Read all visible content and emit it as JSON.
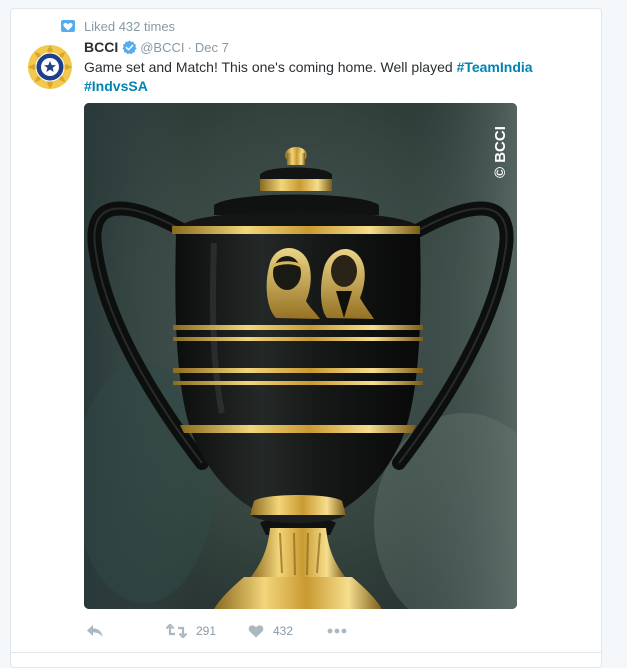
{
  "context": {
    "text": "Liked 432 times",
    "icon": "heart-badge-icon"
  },
  "tweet": {
    "fullname": "BCCI",
    "handle": "@BCCI",
    "separator": "·",
    "time": "Dec 7",
    "text_plain": "Game set and Match! This one's coming home. Well played ",
    "hashtag_1": "#TeamIndia",
    "hashtag_2": "#IndvsSA",
    "photo_watermark": "© BCCI",
    "photo_alt": "trophy"
  },
  "actions": {
    "reply_icon": "reply-icon",
    "retweet_count": "291",
    "like_count": "432",
    "more_icon": "more-icon"
  },
  "colors": {
    "link": "#0084b4",
    "muted": "#8899a6",
    "accent": "#55acee",
    "border": "#e1e8ed"
  }
}
